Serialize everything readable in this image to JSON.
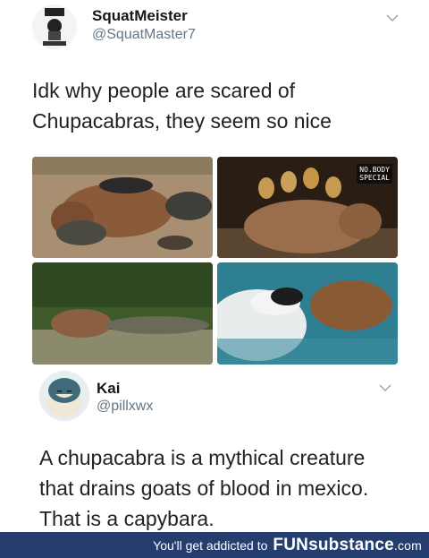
{
  "tweet1": {
    "display_name": "SquatMeister",
    "handle": "@SquatMaster7",
    "text_line1": "Idk why people are scared of",
    "text_line2": "Chupacabras, they seem so nice",
    "watermark_line1": "NO.BODY",
    "watermark_line2": "SPECIAL"
  },
  "tweet2": {
    "display_name": "Kai",
    "handle": "@pillxwx",
    "text_line1": "A chupacabra is a mythical creature",
    "text_line2": "that drains goats of blood in mexico.",
    "text_line3": "That is a capybara."
  },
  "footer": {
    "tagline": "You'll get addicted to",
    "brand_part1": "FUN",
    "brand_part2": "substance",
    "brand_part3": ".com",
    "bg_color": "#263d6f"
  },
  "colors": {
    "handle": "#657786",
    "text": "#14171a"
  },
  "icons": [
    "chevron-down-icon",
    "avatar"
  ]
}
